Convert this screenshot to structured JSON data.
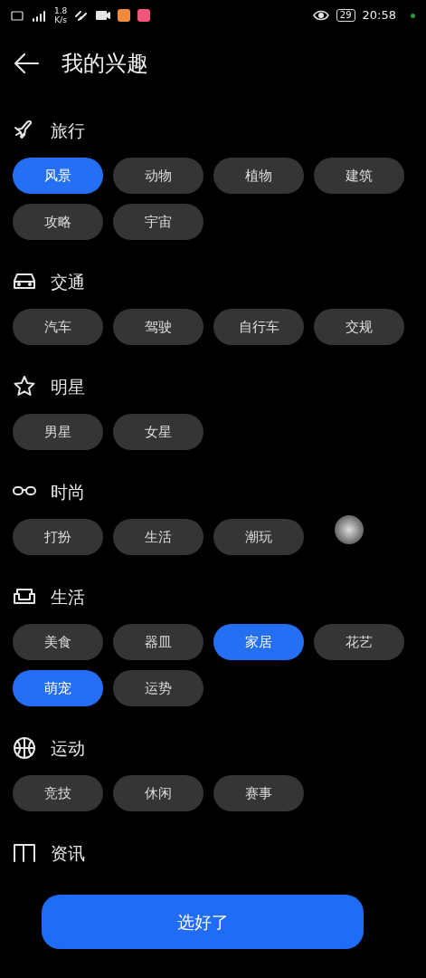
{
  "status_bar": {
    "speed": "1.8",
    "speed_unit": "K/s",
    "battery": "29",
    "time": "20:58"
  },
  "header": {
    "title": "我的兴趣"
  },
  "categories": [
    {
      "title": "旅行",
      "tags": [
        {
          "label": "风景",
          "selected": true
        },
        {
          "label": "动物",
          "selected": false
        },
        {
          "label": "植物",
          "selected": false
        },
        {
          "label": "建筑",
          "selected": false
        },
        {
          "label": "攻略",
          "selected": false
        },
        {
          "label": "宇宙",
          "selected": false
        }
      ]
    },
    {
      "title": "交通",
      "tags": [
        {
          "label": "汽车",
          "selected": false
        },
        {
          "label": "驾驶",
          "selected": false
        },
        {
          "label": "自行车",
          "selected": false
        },
        {
          "label": "交规",
          "selected": false
        }
      ]
    },
    {
      "title": "明星",
      "tags": [
        {
          "label": "男星",
          "selected": false
        },
        {
          "label": "女星",
          "selected": false
        }
      ]
    },
    {
      "title": "时尚",
      "tags": [
        {
          "label": "打扮",
          "selected": false
        },
        {
          "label": "生活",
          "selected": false
        },
        {
          "label": "潮玩",
          "selected": false
        }
      ]
    },
    {
      "title": "生活",
      "tags": [
        {
          "label": "美食",
          "selected": false
        },
        {
          "label": "器皿",
          "selected": false
        },
        {
          "label": "家居",
          "selected": true
        },
        {
          "label": "花艺",
          "selected": false
        },
        {
          "label": "萌宠",
          "selected": true
        },
        {
          "label": "运势",
          "selected": false
        }
      ]
    },
    {
      "title": "运动",
      "tags": [
        {
          "label": "竞技",
          "selected": false
        },
        {
          "label": "休闲",
          "selected": false
        },
        {
          "label": "赛事",
          "selected": false
        }
      ]
    },
    {
      "title": "资讯"
    }
  ],
  "confirm_button": {
    "label": "选好了"
  }
}
